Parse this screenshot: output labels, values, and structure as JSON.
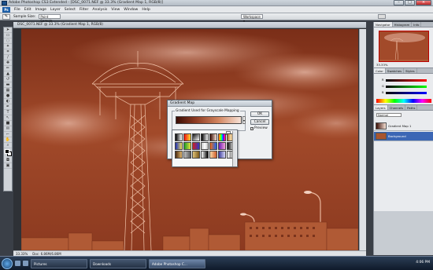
{
  "app": {
    "title": "Adobe Photoshop CS3 Extended - [DSC_0071.NEF @ 33.3% (Gradient Map 1, RGB/8)]"
  },
  "menu": [
    "File",
    "Edit",
    "Image",
    "Layer",
    "Select",
    "Filter",
    "Analysis",
    "View",
    "Window",
    "Help"
  ],
  "options": {
    "sample_size_label": "Sample Size:",
    "sample_size_value": "Point Sample",
    "workspace": "Workspace ▾"
  },
  "document": {
    "title": "DSC_0071.NEF @ 33.3% (Gradient Map 1, RGB/8)",
    "zoom": "33.33%",
    "doc_size": "Doc: 6.86M/6.86M"
  },
  "dialog": {
    "title": "Gradient Map",
    "group_label": "Gradient Used for Grayscale Mapping",
    "ok": "OK",
    "cancel": "Cancel",
    "preview": "Preview",
    "dither": "Dither",
    "reverse": "Reverse"
  },
  "swatches": [
    "linear-gradient(90deg,#000,#fff)",
    "linear-gradient(90deg,#e11,#fd3)",
    "linear-gradient(135deg,#111,#fff)",
    "linear-gradient(90deg,#000,transparent)",
    "linear-gradient(90deg,#3a0d05,#f7e2d6)",
    "linear-gradient(90deg,#f00,#ff0,#0f0,#0ff,#00f,#f0f,#f00)",
    "linear-gradient(90deg,#a76c2b,#f2d9a8,#a76c2b)",
    "linear-gradient(90deg,#1e2fb8,#f3e35c)",
    "linear-gradient(90deg,#1a9a2b,#e7e23a)",
    "linear-gradient(90deg,#d41d1d,#2a3ac7)",
    "linear-gradient(90deg,#c4c4c4,#fff,#c4c4c4)",
    "linear-gradient(90deg,#f06a1a,#1a66f0)",
    "linear-gradient(90deg,#6c1bb8,#f2a2d6)",
    "linear-gradient(90deg,#111,#7d7d7d,#fff)",
    "linear-gradient(90deg,#4a2a10,#e4b86d)",
    "linear-gradient(90deg,#c0c0c0,#5b5b5b)",
    "linear-gradient(90deg,#e0c27a,#7b5a1c)",
    "linear-gradient(90deg,#fff,#000)",
    "linear-gradient(90deg,#f9d9a8,#cf5d2b)",
    "linear-gradient(90deg,#3b3b9c,#d8d8f6)",
    "linear-gradient(90deg,#fff,#999,#fff)"
  ],
  "panels": {
    "nav_tabs": [
      "Navigator",
      "Histogram",
      "Info"
    ],
    "color_tabs": [
      "Color",
      "Swatches",
      "Styles"
    ],
    "layers_tabs": [
      "Layers",
      "Channels",
      "Paths"
    ],
    "nav_zoom": "33.33%",
    "layers_mode": "Normal",
    "layers": [
      {
        "name": "Gradient Map 1",
        "selected": false
      },
      {
        "name": "Background",
        "selected": true
      }
    ]
  },
  "taskbar": {
    "tasks": [
      {
        "label": "Pictures",
        "active": false
      },
      {
        "label": "Downloads",
        "active": false
      },
      {
        "label": "Adobe Photoshop C...",
        "active": true
      }
    ],
    "clock": "4:06 PM"
  },
  "colors": {
    "accent": "#3b66b5",
    "canvas_tint": "#a9552f"
  }
}
